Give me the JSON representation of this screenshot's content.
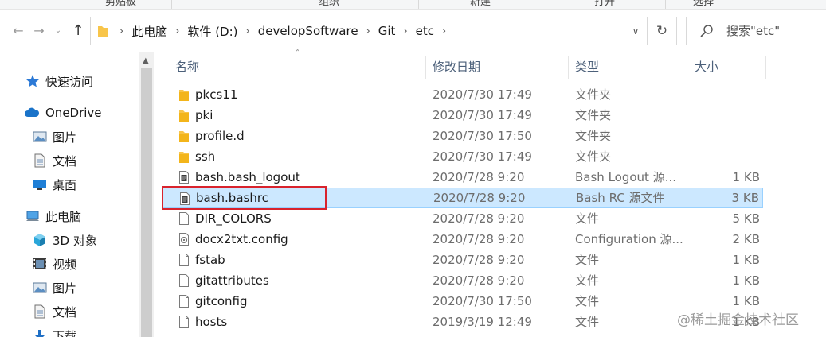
{
  "ribbon": {
    "labels": [
      "剪贴板",
      "组织",
      "新建",
      "打开",
      "选择"
    ]
  },
  "address_bar": {
    "crumbs": [
      "此电脑",
      "软件 (D:)",
      "developSoftware",
      "Git",
      "etc"
    ],
    "search_placeholder": "搜索\"etc\""
  },
  "icons": {
    "back": "back-arrow-icon",
    "forward": "forward-arrow-icon",
    "recent": "chevron-down-icon",
    "up": "up-arrow-icon",
    "refresh": "refresh-icon",
    "search": "search-icon"
  },
  "nav_pane": {
    "items": [
      {
        "label": "快速访问",
        "icon": "star-icon"
      },
      {
        "label": "OneDrive",
        "icon": "cloud-icon"
      },
      {
        "label": "图片",
        "icon": "pictures-icon"
      },
      {
        "label": "文档",
        "icon": "documents-icon"
      },
      {
        "label": "桌面",
        "icon": "desktop-icon"
      },
      {
        "label": "此电脑",
        "icon": "computer-icon"
      },
      {
        "label": "3D 对象",
        "icon": "cube-icon"
      },
      {
        "label": "视频",
        "icon": "video-icon"
      },
      {
        "label": "图片",
        "icon": "pictures-icon"
      },
      {
        "label": "文档",
        "icon": "documents-icon"
      },
      {
        "label": "下载",
        "icon": "download-icon"
      }
    ]
  },
  "file_list": {
    "columns": {
      "name": "名称",
      "date": "修改日期",
      "type": "类型",
      "size": "大小"
    },
    "rows": [
      {
        "name": "pkcs11",
        "date": "2020/7/30 17:49",
        "type": "文件夹",
        "size": "",
        "icon": "folder-icon"
      },
      {
        "name": "pki",
        "date": "2020/7/30 17:49",
        "type": "文件夹",
        "size": "",
        "icon": "folder-icon"
      },
      {
        "name": "profile.d",
        "date": "2020/7/30 17:50",
        "type": "文件夹",
        "size": "",
        "icon": "folder-icon"
      },
      {
        "name": "ssh",
        "date": "2020/7/30 17:49",
        "type": "文件夹",
        "size": "",
        "icon": "folder-icon"
      },
      {
        "name": "bash.bash_logout",
        "date": "2020/7/28 9:20",
        "type": "Bash Logout 源...",
        "size": "1 KB",
        "icon": "file-icon"
      },
      {
        "name": "bash.bashrc",
        "date": "2020/7/28 9:20",
        "type": "Bash RC 源文件",
        "size": "3 KB",
        "icon": "file-icon",
        "selected": true
      },
      {
        "name": "DIR_COLORS",
        "date": "2020/7/28 9:20",
        "type": "文件",
        "size": "5 KB",
        "icon": "blank-file-icon"
      },
      {
        "name": "docx2txt.config",
        "date": "2020/7/28 9:20",
        "type": "Configuration 源...",
        "size": "2 KB",
        "icon": "config-file-icon"
      },
      {
        "name": "fstab",
        "date": "2020/7/28 9:20",
        "type": "文件",
        "size": "1 KB",
        "icon": "blank-file-icon"
      },
      {
        "name": "gitattributes",
        "date": "2020/7/28 9:20",
        "type": "文件",
        "size": "1 KB",
        "icon": "blank-file-icon"
      },
      {
        "name": "gitconfig",
        "date": "2020/7/30 17:50",
        "type": "文件",
        "size": "1 KB",
        "icon": "blank-file-icon"
      },
      {
        "name": "hosts",
        "date": "2019/3/19 12:49",
        "type": "文件",
        "size": "1 KB",
        "icon": "blank-file-icon"
      }
    ]
  },
  "colors": {
    "selection_bg": "#cce8ff",
    "selection_border": "#99d1ff",
    "highlight_outline": "#d9232d",
    "folder": "#f8c54a",
    "column_header": "#4c607a"
  },
  "watermark": "@稀土掘金技术社区"
}
